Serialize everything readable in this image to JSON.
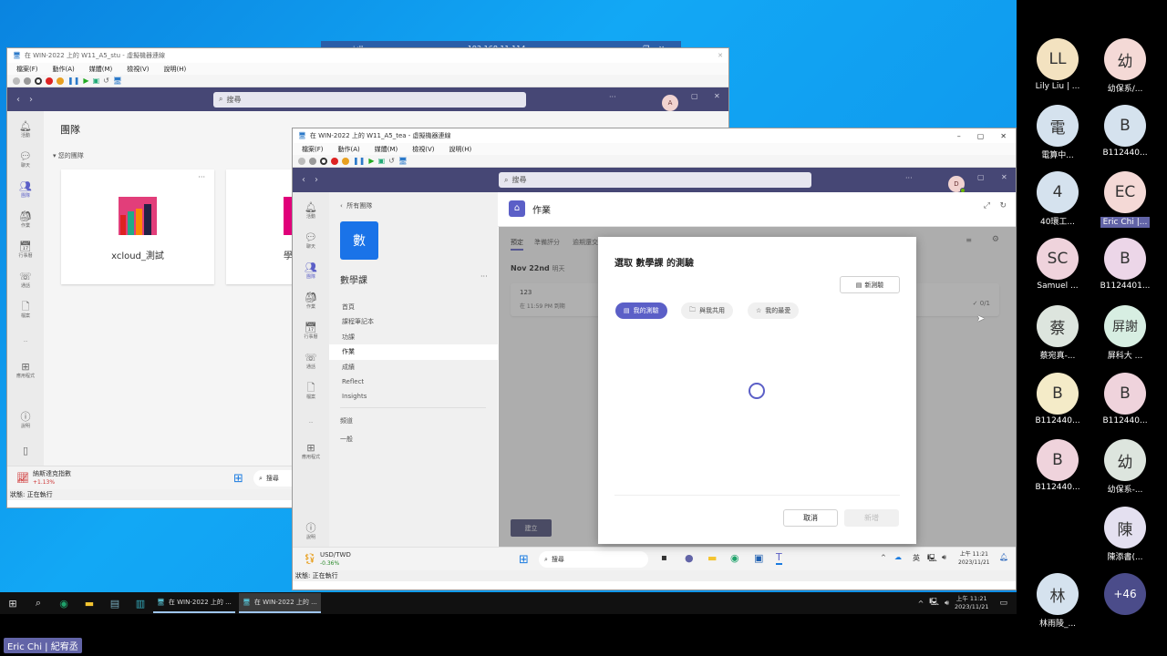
{
  "rdp_bar": {
    "ip": "192.168.11.114"
  },
  "student_window": {
    "title": "在 WIN-2022 上的 W11_A5_stu - 虛擬機器連線",
    "menu": [
      "檔案(F)",
      "動作(A)",
      "媒體(M)",
      "檢視(V)",
      "說明(H)"
    ],
    "search_placeholder": "搜尋",
    "avatar_initial": "A",
    "page_title": "團隊",
    "section_label": "您的團隊",
    "rail": [
      "活動",
      "聊天",
      "團隊",
      "作業",
      "行事曆",
      "通話",
      "檔案",
      "...",
      "應用程式",
      "說明"
    ],
    "teams": [
      {
        "name": "xcloud_測試"
      },
      {
        "name": "學"
      }
    ],
    "widget": {
      "title": "納斯達克指數",
      "change": "+1.13%"
    },
    "taskbar_search": "搜尋",
    "status": "狀態: 正在執行"
  },
  "teacher_window": {
    "title": "在 WIN-2022 上的 W11_A5_tea - 虛擬機器連線",
    "menu": [
      "檔案(F)",
      "動作(A)",
      "媒體(M)",
      "檢視(V)",
      "說明(H)"
    ],
    "search_placeholder": "搜尋",
    "avatar_initial": "D",
    "rail": [
      "活動",
      "聊天",
      "團隊",
      "作業",
      "行事曆",
      "通話",
      "檔案",
      "...",
      "應用程式",
      "說明"
    ],
    "back_label": "所有團隊",
    "team_badge": "數",
    "team_name": "數學課",
    "nav": [
      "首頁",
      "課程筆記本",
      "功課",
      "作業",
      "成績",
      "Reflect",
      "Insights"
    ],
    "nav_active": "作業",
    "channels_label": "頻道",
    "channel": "一般",
    "assignments_title": "作業",
    "tabs": [
      "預定",
      "準備評分",
      "逾期還交"
    ],
    "date_heading": "Nov 22nd",
    "date_sub": "明天",
    "assignment": {
      "name": "123",
      "due": "在 11:59 PM 到期",
      "count": "0/1"
    },
    "create_label": "建立",
    "widget": {
      "title": "USD/TWD",
      "change": "-0.36%"
    },
    "taskbar_search": "搜尋",
    "clock": {
      "time": "上午 11:21",
      "date": "2023/11/21"
    },
    "ime": "英",
    "status": "狀態: 正在執行"
  },
  "modal": {
    "title": "選取 數學課 的測驗",
    "new_quiz": "新測驗",
    "filters": [
      "我的測驗",
      "與我共用",
      "我的最愛"
    ],
    "cancel": "取消",
    "add": "新增"
  },
  "host_taskbar": {
    "apps": [
      "在 WIN-2022 上的 ...",
      "在 WIN-2022 上的 ..."
    ],
    "clock": {
      "time": "上午 11:21",
      "date": "2023/11/21"
    }
  },
  "presenter": "Eric Chi | 紀宥丞",
  "participants": [
    {
      "initials": "LL",
      "name": "Lily Liu | ...",
      "color": "#f3e2c0"
    },
    {
      "initials": "幼",
      "name": "幼保系/...",
      "color": "#f4d9d6"
    },
    {
      "initials": "電",
      "name": "電算中...",
      "color": "#d5e2ee"
    },
    {
      "initials": "B",
      "name": "B112440...",
      "color": "#d5e2ee"
    },
    {
      "initials": "4",
      "name": "40環工...",
      "color": "#d5e2ee"
    },
    {
      "initials": "EC",
      "name": "Eric Chi |...",
      "color": "#f4d9d6",
      "highlight": true
    },
    {
      "initials": "SC",
      "name": "Samuel ...",
      "color": "#efd3dc"
    },
    {
      "initials": "B",
      "name": "B1124401...",
      "color": "#ecd6e8"
    },
    {
      "initials": "蔡",
      "name": "蔡宛真-...",
      "color": "#dde5de"
    },
    {
      "initials": "屏謝",
      "name": "屏科大 ...",
      "color": "#d7eee2"
    },
    {
      "initials": "B",
      "name": "B112440...",
      "color": "#f4ebc8"
    },
    {
      "initials": "B",
      "name": "B112440...",
      "color": "#efd3dc"
    },
    {
      "initials": "B",
      "name": "B112440...",
      "color": "#efd3dc"
    },
    {
      "initials": "幼",
      "name": "幼保系-...",
      "color": "#dde5de"
    },
    {
      "initials": "陳",
      "name": "陳添書(...",
      "color": "#e4e0f0"
    },
    {
      "initials": "林",
      "name": "林雨陵_...",
      "color": "#d5e2ee"
    }
  ],
  "more_participants": "+46"
}
